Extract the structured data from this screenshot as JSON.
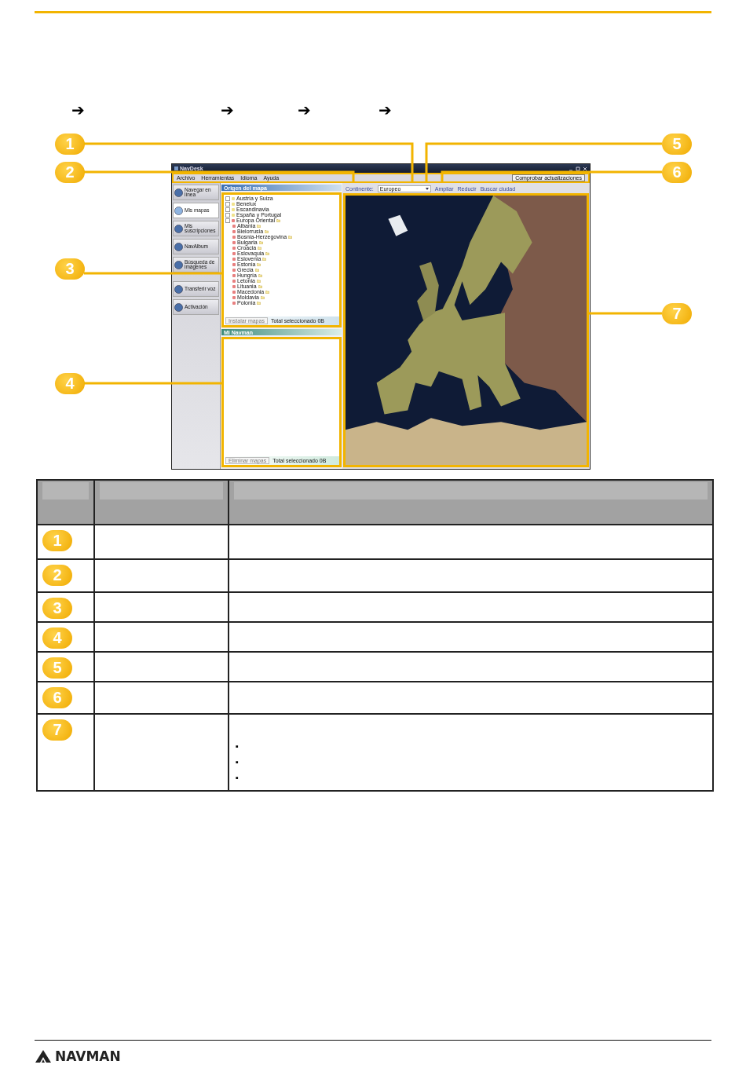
{
  "breadcrumb_arrows": [
    "➔",
    "➔",
    "➔",
    "➔"
  ],
  "app": {
    "title": "NavDesk",
    "menu": [
      "Archivo",
      "Herramientas",
      "Idioma",
      "Ayuda"
    ],
    "check_updates": "Comprobar actualizaciones",
    "sidebar": [
      {
        "label": "Navegar en línea",
        "selected": false
      },
      {
        "label": "Mis mapas",
        "selected": true
      },
      {
        "label": "Mis suscripciones",
        "selected": false
      },
      {
        "label": "NavAlbum",
        "selected": false
      },
      {
        "label": "Búsqueda de imágenes",
        "selected": false
      },
      {
        "label": "Transferir voz",
        "selected": false
      },
      {
        "label": "Activación",
        "selected": false
      }
    ],
    "map_source": {
      "title": "Origen del mapa",
      "tree": [
        {
          "label": "Austria y Suiza",
          "color": "#f0e28c",
          "checked": false
        },
        {
          "label": "Benelux",
          "color": "#f0e28c",
          "checked": false
        },
        {
          "label": "Escandinavia",
          "color": "#f0e28c",
          "checked": false
        },
        {
          "label": "España y Portugal",
          "color": "#f0e28c",
          "checked": false
        },
        {
          "label": "Europa Oriental",
          "color": "#e88080",
          "checked": false,
          "children": [
            {
              "label": "Albania",
              "color": "#e88080"
            },
            {
              "label": "Bielorrusia",
              "color": "#e88080"
            },
            {
              "label": "Bosnia-Herzegovina",
              "color": "#e88080"
            },
            {
              "label": "Bulgaria",
              "color": "#e88080"
            },
            {
              "label": "Croacia",
              "color": "#e88080"
            },
            {
              "label": "Eslovaquia",
              "color": "#e88080"
            },
            {
              "label": "Eslovenia",
              "color": "#e88080"
            },
            {
              "label": "Estonia",
              "color": "#e88080"
            },
            {
              "label": "Grecia",
              "color": "#e88080"
            },
            {
              "label": "Hungría",
              "color": "#e88080"
            },
            {
              "label": "Letonia",
              "color": "#e88080"
            },
            {
              "label": "Lituania",
              "color": "#e88080"
            },
            {
              "label": "Macedonia",
              "color": "#e88080"
            },
            {
              "label": "Moldavia",
              "color": "#e88080"
            },
            {
              "label": "Polonia",
              "color": "#e88080"
            }
          ]
        }
      ],
      "install_button": "Instalar mapas",
      "total": "Total seleccionado 0B"
    },
    "my_navman": {
      "title": "Mi Navman",
      "remove_button": "Eliminar mapas",
      "total": "Total seleccionado 0B"
    },
    "toolbar": {
      "continent_label": "Continente:",
      "continent_value": "Europeo",
      "zoom_in": "Ampliar",
      "zoom_out": "Reducir",
      "find_city": "Buscar ciudad"
    }
  },
  "callouts": [
    {
      "number": "1"
    },
    {
      "number": "2"
    },
    {
      "number": "3"
    },
    {
      "number": "4"
    },
    {
      "number": "5"
    },
    {
      "number": "6"
    },
    {
      "number": "7"
    }
  ],
  "table": {
    "rows": [
      {
        "number": "1"
      },
      {
        "number": "2"
      },
      {
        "number": "3"
      },
      {
        "number": "4"
      },
      {
        "number": "5"
      },
      {
        "number": "6"
      },
      {
        "number": "7",
        "bullets": [
          "▪",
          "▪",
          "▪"
        ]
      }
    ]
  },
  "footer": {
    "brand": "NAVMAN"
  }
}
